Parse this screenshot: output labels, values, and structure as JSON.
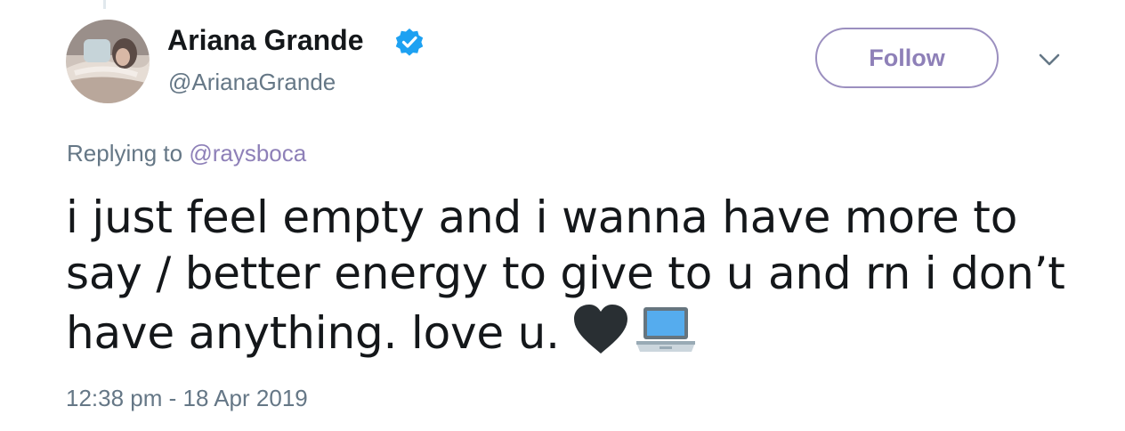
{
  "author": {
    "display_name": "Ariana Grande",
    "handle": "@ArianaGrande",
    "verified": true,
    "avatar_icon": "profile-photo"
  },
  "actions": {
    "follow_label": "Follow",
    "menu_icon": "chevron-down-icon"
  },
  "reply": {
    "prefix": "Replying to",
    "handle": "@raysboca"
  },
  "tweet": {
    "text": "i just feel empty and i wanna have more to say / better energy to give to u and rn i don’t have anything. love u.",
    "emojis": [
      "black-heart-emoji",
      "laptop-emoji"
    ]
  },
  "timestamp": "12:38 pm - 18 Apr 2019",
  "colors": {
    "accent": "#8e80b8",
    "secondary_text": "#657786",
    "verified": "#1da1f2"
  }
}
